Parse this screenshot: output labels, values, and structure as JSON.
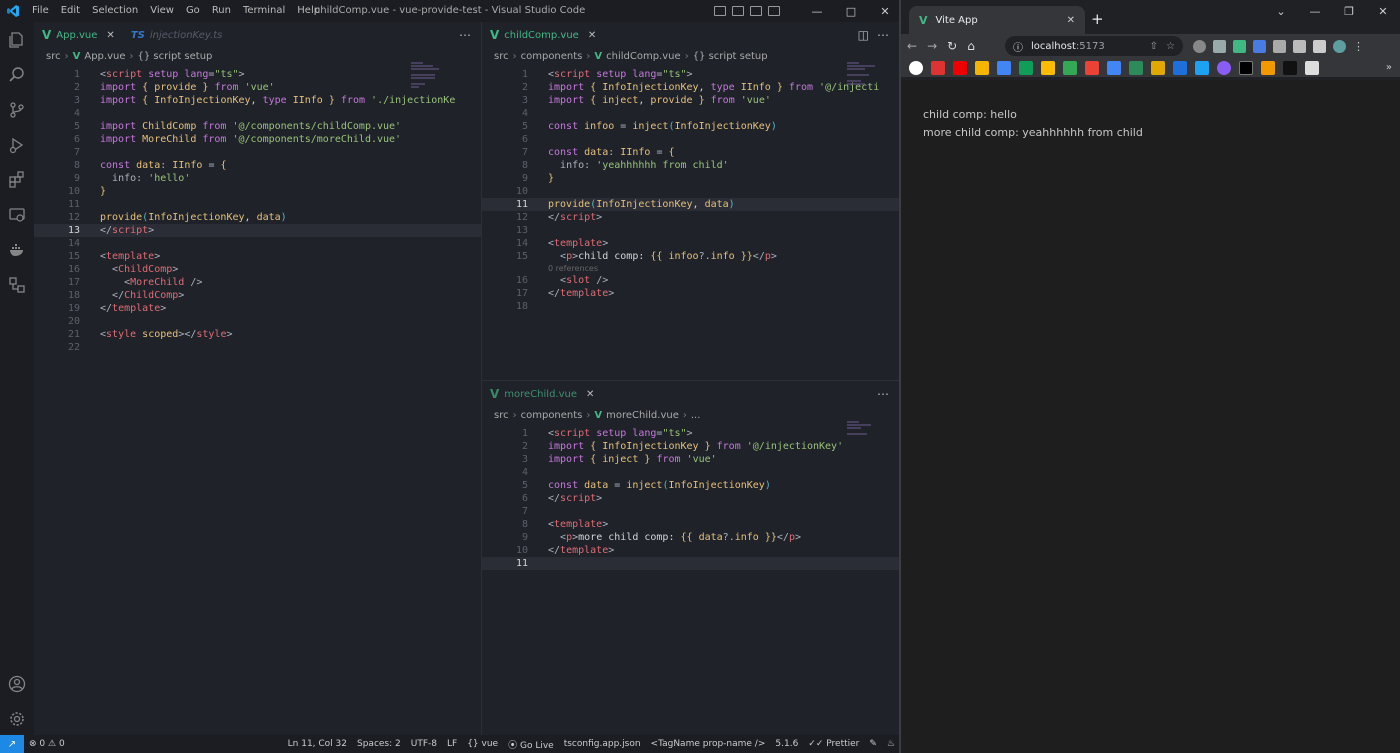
{
  "vscode": {
    "menu": [
      "File",
      "Edit",
      "Selection",
      "View",
      "Go",
      "Run",
      "Terminal",
      "Help"
    ],
    "window_title": "childComp.vue - vue-provide-test - Visual Studio Code",
    "left": {
      "tab_active": "App.vue",
      "tab_other": "injectionKey.ts",
      "tab_other_badge": "TS",
      "crumbs": [
        "src",
        "App.vue",
        "{} script setup"
      ]
    },
    "top_right": {
      "tab": "childComp.vue",
      "crumbs": [
        "src",
        "components",
        "childComp.vue",
        "{} script setup"
      ],
      "codelens": "0 references"
    },
    "bottom_right": {
      "tab": "moreChild.vue",
      "crumbs": [
        "src",
        "components",
        "moreChild.vue",
        "..."
      ]
    },
    "status": {
      "errors": "0",
      "warnings": "0",
      "position": "Ln 11, Col 32",
      "spaces": "Spaces: 2",
      "encoding": "UTF-8",
      "eol": "LF",
      "language": "vue",
      "go_live": "Go Live",
      "tsconfig": "tsconfig.app.json",
      "tagname": "<TagName prop-name />",
      "version": "5.1.6",
      "prettier": "Prettier"
    }
  },
  "chrome": {
    "tab_title": "Vite App",
    "url_host": "localhost",
    "url_port": ":5173",
    "page_lines": [
      "child comp: hello",
      "more child comp: yeahhhhhh from child"
    ]
  }
}
